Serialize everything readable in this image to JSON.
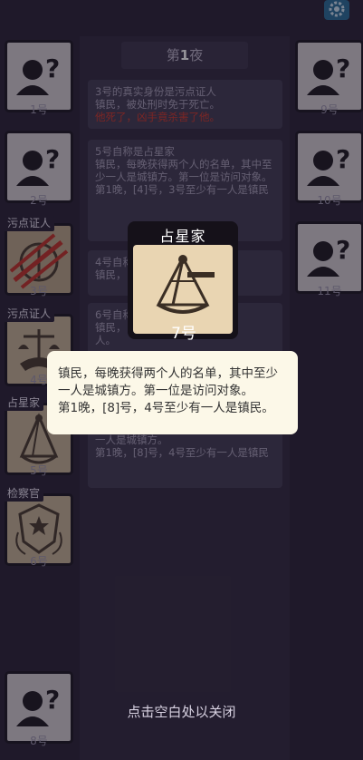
{
  "night": {
    "prefix": "第",
    "num": "1",
    "suffix": "夜"
  },
  "log": [
    {
      "line1": "3号的真实身份是污点证人",
      "line2": "镇民，被处刑时免于死亡。",
      "line3": "他死了，凶手竟杀害了他。"
    },
    {
      "line1": "5号自称是占星家",
      "line2": "镇民，每晚获得两个人的名单，其中至少一人是城镇方。第一位是访问对象。",
      "line3": "第1晚，[4]号，3号至少有一人是镇民"
    },
    {
      "line1": "4号自称",
      "line2": "镇民，"
    },
    {
      "line1": "6号自称",
      "line2": "镇民，",
      "line3": "人。"
    },
    {
      "line1": "",
      "line2": "一人是城镇方。",
      "line3": "第1晚，[8]号，4号至少有一人是镇民"
    }
  ],
  "players": {
    "p1": "1号",
    "p2": "2号",
    "p3": "3号",
    "p4": "4号",
    "p5": "5号",
    "p6": "6号",
    "p7": "7号",
    "p8": "8号",
    "p9": "9号",
    "p10": "10号",
    "p11": "11号"
  },
  "roles": {
    "p3": "污点证人",
    "p4": "污点证人",
    "p5": "占星家",
    "p6": "检察官"
  },
  "card": {
    "title": "占星家",
    "number": "7号"
  },
  "description": {
    "text1": "镇民，每晚获得两个人的名单，其中至少一人是城镇方。第一位是访问对象。",
    "text2": "第1晚，[8]号，4号至少有一人是镇民。"
  },
  "close_hint": "点击空白处以关闭",
  "icons": {
    "settings": "gear-icon",
    "unknown": "unknown-person-icon"
  },
  "colors": {
    "accent_red": "#d43b2c",
    "background": "#2a2438",
    "card": "#e9d5b2"
  }
}
